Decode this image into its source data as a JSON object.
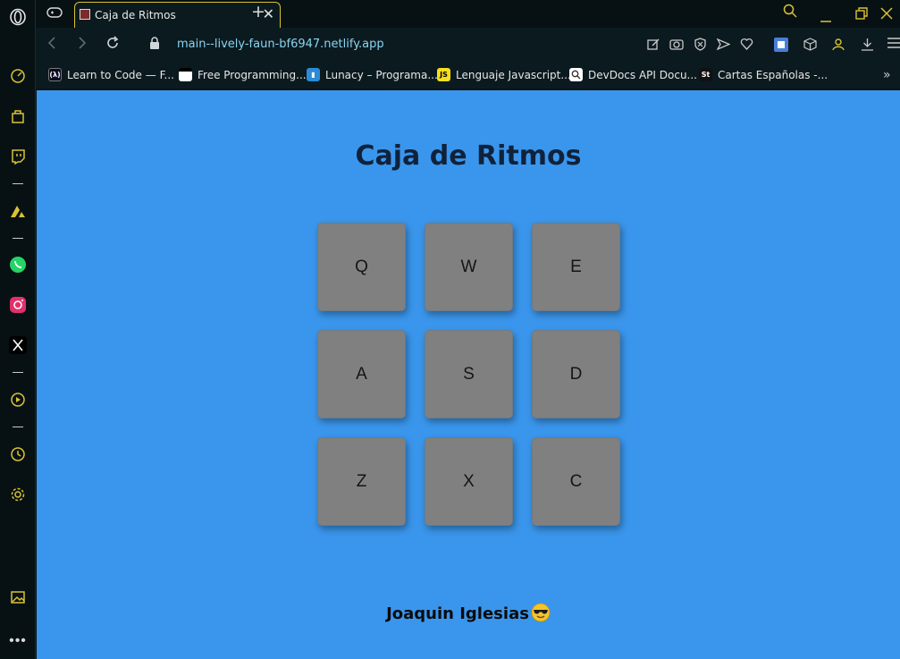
{
  "browser": {
    "tab_title": "Caja de Ritmos",
    "new_tab_symbol": "+",
    "close_tab_symbol": "✕",
    "url_host": "main--lively-faun-bf6947.netlify.app",
    "accent_color": "#d9c233"
  },
  "bookmarks": [
    {
      "label": "Learn to Code — F...",
      "icon": "freecodecamp-icon"
    },
    {
      "label": "Free Programming...",
      "icon": "bookmark-site-icon"
    },
    {
      "label": "Lunacy – Programa...",
      "icon": "lunacy-icon"
    },
    {
      "label": "Lenguaje Javascript...",
      "icon": "js-icon"
    },
    {
      "label": "DevDocs API Docu...",
      "icon": "devdocs-icon"
    },
    {
      "label": "Cartas Españolas -...",
      "icon": "st-icon"
    }
  ],
  "bookmark_icon_text": {
    "js": "JS",
    "st": "St"
  },
  "page": {
    "title": "Caja de Ritmos",
    "background_color": "#3a96ec",
    "pads": [
      "Q",
      "W",
      "E",
      "A",
      "S",
      "D",
      "Z",
      "X",
      "C"
    ],
    "pad_color": "#808080",
    "footer": "Joaquin Iglesias"
  }
}
